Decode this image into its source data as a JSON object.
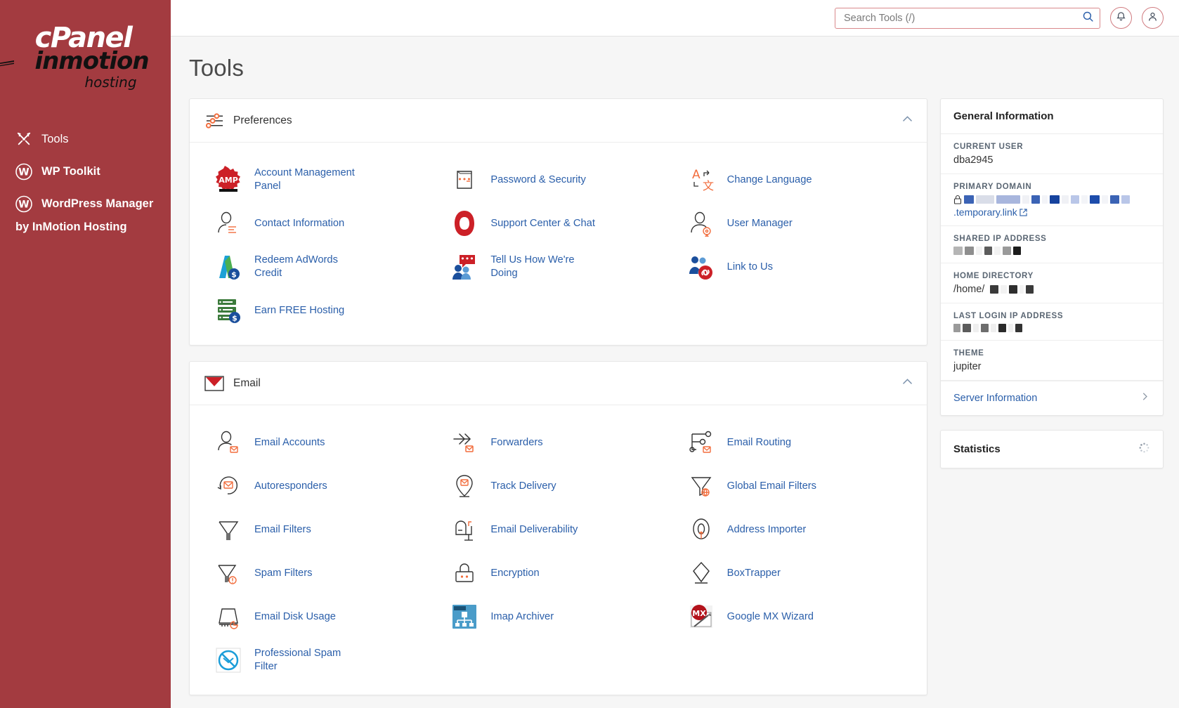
{
  "sidebar": {
    "logo": {
      "cpanel": "cPanel",
      "inmotion": "inmotion",
      "hosting": "hosting"
    },
    "items": [
      {
        "label": "Tools",
        "icon": "tools-icon"
      },
      {
        "label": "WP Toolkit",
        "icon": "wordpress-icon"
      },
      {
        "label": "WordPress Manager",
        "icon": "wordpress-icon"
      }
    ],
    "subtitle": "by InMotion Hosting"
  },
  "header": {
    "search_placeholder": "Search Tools (/)",
    "search_value": "",
    "search_icon": "search-icon",
    "bell_icon": "bell-icon",
    "user_icon": "user-icon"
  },
  "page": {
    "title": "Tools"
  },
  "sections": [
    {
      "title": "Preferences",
      "icon": "sliders-icon",
      "collapse_icon": "chevron-up-icon",
      "tools": [
        {
          "label": "Account Management Panel",
          "icon": "amp-icon"
        },
        {
          "label": "Password & Security",
          "icon": "password-icon"
        },
        {
          "label": "Change Language",
          "icon": "language-icon"
        },
        {
          "label": "Contact Information",
          "icon": "contact-icon"
        },
        {
          "label": "Support Center & Chat",
          "icon": "support-icon"
        },
        {
          "label": "User Manager",
          "icon": "user-manager-icon"
        },
        {
          "label": "Redeem AdWords Credit",
          "icon": "adwords-icon"
        },
        {
          "label": "Tell Us How We're Doing",
          "icon": "feedback-icon"
        },
        {
          "label": "Link to Us",
          "icon": "link-to-us-icon"
        },
        {
          "label": "Earn FREE Hosting",
          "icon": "free-hosting-icon"
        }
      ]
    },
    {
      "title": "Email",
      "icon": "envelope-icon",
      "collapse_icon": "chevron-up-icon",
      "tools": [
        {
          "label": "Email Accounts",
          "icon": "email-accounts-icon"
        },
        {
          "label": "Forwarders",
          "icon": "forwarders-icon"
        },
        {
          "label": "Email Routing",
          "icon": "email-routing-icon"
        },
        {
          "label": "Autoresponders",
          "icon": "autoresponders-icon"
        },
        {
          "label": "Track Delivery",
          "icon": "track-delivery-icon"
        },
        {
          "label": "Global Email Filters",
          "icon": "global-email-filters-icon"
        },
        {
          "label": "Email Filters",
          "icon": "email-filters-icon"
        },
        {
          "label": "Email Deliverability",
          "icon": "email-deliverability-icon"
        },
        {
          "label": "Address Importer",
          "icon": "address-importer-icon"
        },
        {
          "label": "Spam Filters",
          "icon": "spam-filters-icon"
        },
        {
          "label": "Encryption",
          "icon": "encryption-icon"
        },
        {
          "label": "BoxTrapper",
          "icon": "boxtrapper-icon"
        },
        {
          "label": "Email Disk Usage",
          "icon": "email-disk-usage-icon"
        },
        {
          "label": "Imap Archiver",
          "icon": "imap-archiver-icon"
        },
        {
          "label": "Google MX Wizard",
          "icon": "google-mx-wizard-icon"
        },
        {
          "label": "Professional Spam Filter",
          "icon": "professional-spam-filter-icon"
        }
      ]
    }
  ],
  "general_information": {
    "title": "General Information",
    "rows": [
      {
        "label": "CURRENT USER",
        "value": "dba2945",
        "redacted": false
      },
      {
        "label": "PRIMARY DOMAIN",
        "value": "",
        "redacted": true,
        "prefix_icon": "lock-icon",
        "suffix": ".temporary.link",
        "suffix_icon": "external-link-icon"
      },
      {
        "label": "SHARED IP ADDRESS",
        "value": "",
        "redacted": true
      },
      {
        "label": "HOME DIRECTORY",
        "value": "/home/",
        "redacted": true
      },
      {
        "label": "LAST LOGIN IP ADDRESS",
        "value": "",
        "redacted": true
      },
      {
        "label": "THEME",
        "value": "jupiter",
        "redacted": false
      }
    ],
    "server_information_label": "Server Information",
    "server_information_icon": "chevron-right-icon"
  },
  "statistics": {
    "title": "Statistics",
    "loading_icon": "spinner-icon"
  },
  "colors": {
    "sidebar_bg": "#a33b40",
    "link_blue": "#2b5faa",
    "accent_orange": "#f26d3d",
    "accent_red": "#cc2027",
    "border": "#e6e6e6"
  }
}
